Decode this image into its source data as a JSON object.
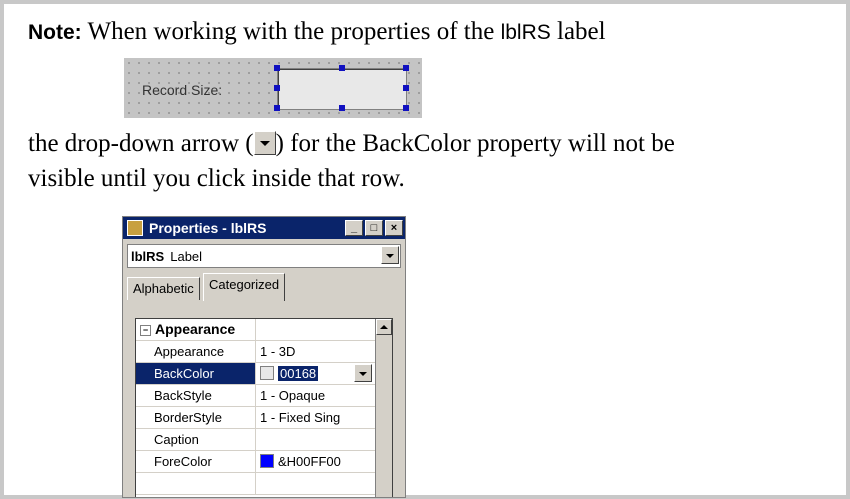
{
  "note": {
    "label": "Note:",
    "text_before": "When working with the properties of the",
    "label_name": "lblRS",
    "text_after": "label"
  },
  "label_mock": {
    "caption": "Record Size:"
  },
  "explanation": {
    "line1_before": "the drop-down arrow (",
    "line1_after": ") for the BackColor property will not be",
    "line2": "visible until you click inside that row."
  },
  "properties_window": {
    "title": "Properties - lblRS",
    "object_name": "lblRS",
    "object_type": "Label",
    "tabs": [
      "Alphabetic",
      "Categorized"
    ],
    "active_tab": "Categorized",
    "rows": [
      {
        "name": "Appearance",
        "value": ""
      },
      {
        "name": "Appearance",
        "value": "1 - 3D"
      },
      {
        "name": "BackColor",
        "value": "00168"
      },
      {
        "name": "BackStyle",
        "value": "1 - Opaque"
      },
      {
        "name": "BorderStyle",
        "value": "1 - Fixed Sing"
      },
      {
        "name": "Caption",
        "value": ""
      },
      {
        "name": "ForeColor",
        "value": "&H00FF00"
      }
    ],
    "colors": {
      "selection": "#0a246a",
      "forecolor_swatch": "#0000ff"
    }
  }
}
